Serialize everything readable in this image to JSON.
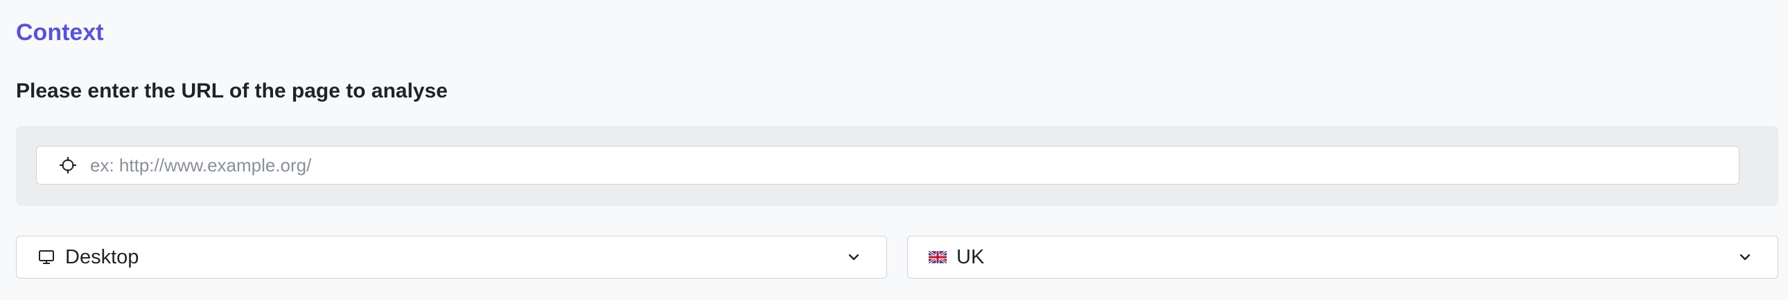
{
  "section": {
    "title": "Context"
  },
  "url_form": {
    "label": "Please enter the URL of the page to analyse",
    "input_value": "",
    "input_placeholder": "ex: http://www.example.org/",
    "input_icon": "crosshair-icon"
  },
  "device_select": {
    "value": "Desktop",
    "icon": "desktop-monitor-icon"
  },
  "country_select": {
    "value": "UK",
    "icon": "uk-flag-icon"
  },
  "colors": {
    "accent": "#5a52d5",
    "panel_bg": "#ebedef",
    "page_bg": "#f8f9fa"
  }
}
